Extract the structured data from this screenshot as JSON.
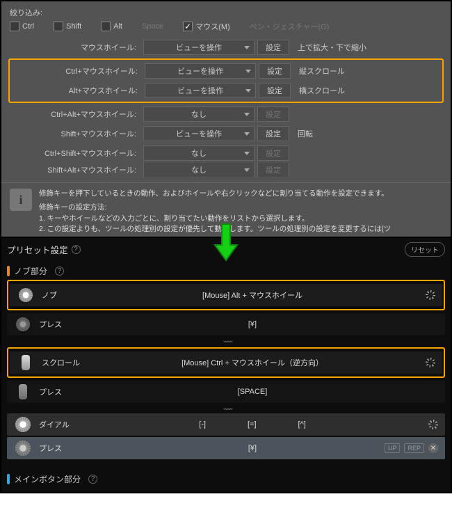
{
  "top": {
    "filter_title": "絞り込み:",
    "checks": {
      "ctrl": "Ctrl",
      "shift": "Shift",
      "alt": "Alt",
      "space": "Space",
      "mouse": "マウス(M)",
      "pen": "ペン・ジェスチャー(G)"
    },
    "rows": [
      {
        "label": "マウスホイール:",
        "select": "ビューを操作",
        "btn": "設定",
        "desc": "上で拡大・下で縮小",
        "disabled": false,
        "hl": 0
      },
      {
        "label": "Ctrl+マウスホイール:",
        "select": "ビューを操作",
        "btn": "設定",
        "desc": "縦スクロール",
        "disabled": false,
        "hl": 1
      },
      {
        "label": "Alt+マウスホイール:",
        "select": "ビューを操作",
        "btn": "設定",
        "desc": "横スクロール",
        "disabled": false,
        "hl": 1
      },
      {
        "label": "Ctrl+Alt+マウスホイール:",
        "select": "なし",
        "btn": "設定",
        "desc": "",
        "disabled": true,
        "hl": 0
      },
      {
        "label": "Shift+マウスホイール:",
        "select": "ビューを操作",
        "btn": "設定",
        "desc": "回転",
        "disabled": false,
        "hl": 0
      },
      {
        "label": "Ctrl+Shift+マウスホイール:",
        "select": "なし",
        "btn": "設定",
        "desc": "",
        "disabled": true,
        "hl": 0
      },
      {
        "label": "Shift+Alt+マウスホイール:",
        "select": "なし",
        "btn": "設定",
        "desc": "",
        "disabled": true,
        "hl": 0
      }
    ],
    "info": {
      "line1": "修飾キーを押下しているときの動作、およびホイールや右クリックなどに割り当てる動作を設定できます。",
      "line2_title": "修飾キーの設定方法:",
      "line3": "1. キーやホイールなどの入力ごとに、割り当てたい動作をリストから選択します。",
      "line4": "2. この設定よりも、ツールの処理別の設定が優先して動作します。ツールの処理別の設定を変更するには[ツ"
    }
  },
  "bot": {
    "title": "プリセット設定",
    "reset": "リセット",
    "section_knob": "ノブ部分",
    "section_main": "メインボタン部分",
    "rows": {
      "knob": {
        "name": "ノブ",
        "mid": "[Mouse] Alt + マウスホイール"
      },
      "press1": {
        "name": "プレス",
        "mid": "[¥]"
      },
      "scroll": {
        "name": "スクロール",
        "mid": "[Mouse] Ctrl + マウスホイール（逆方向）"
      },
      "press2": {
        "name": "プレス",
        "mid": "[SPACE]"
      },
      "dial": {
        "name": "ダイアル",
        "left": "[-]",
        "center": "[=]",
        "right": "[^]"
      },
      "press3": {
        "name": "プレス",
        "mid": "[¥]",
        "p_up": "UP",
        "p_rep": "REP"
      }
    }
  }
}
